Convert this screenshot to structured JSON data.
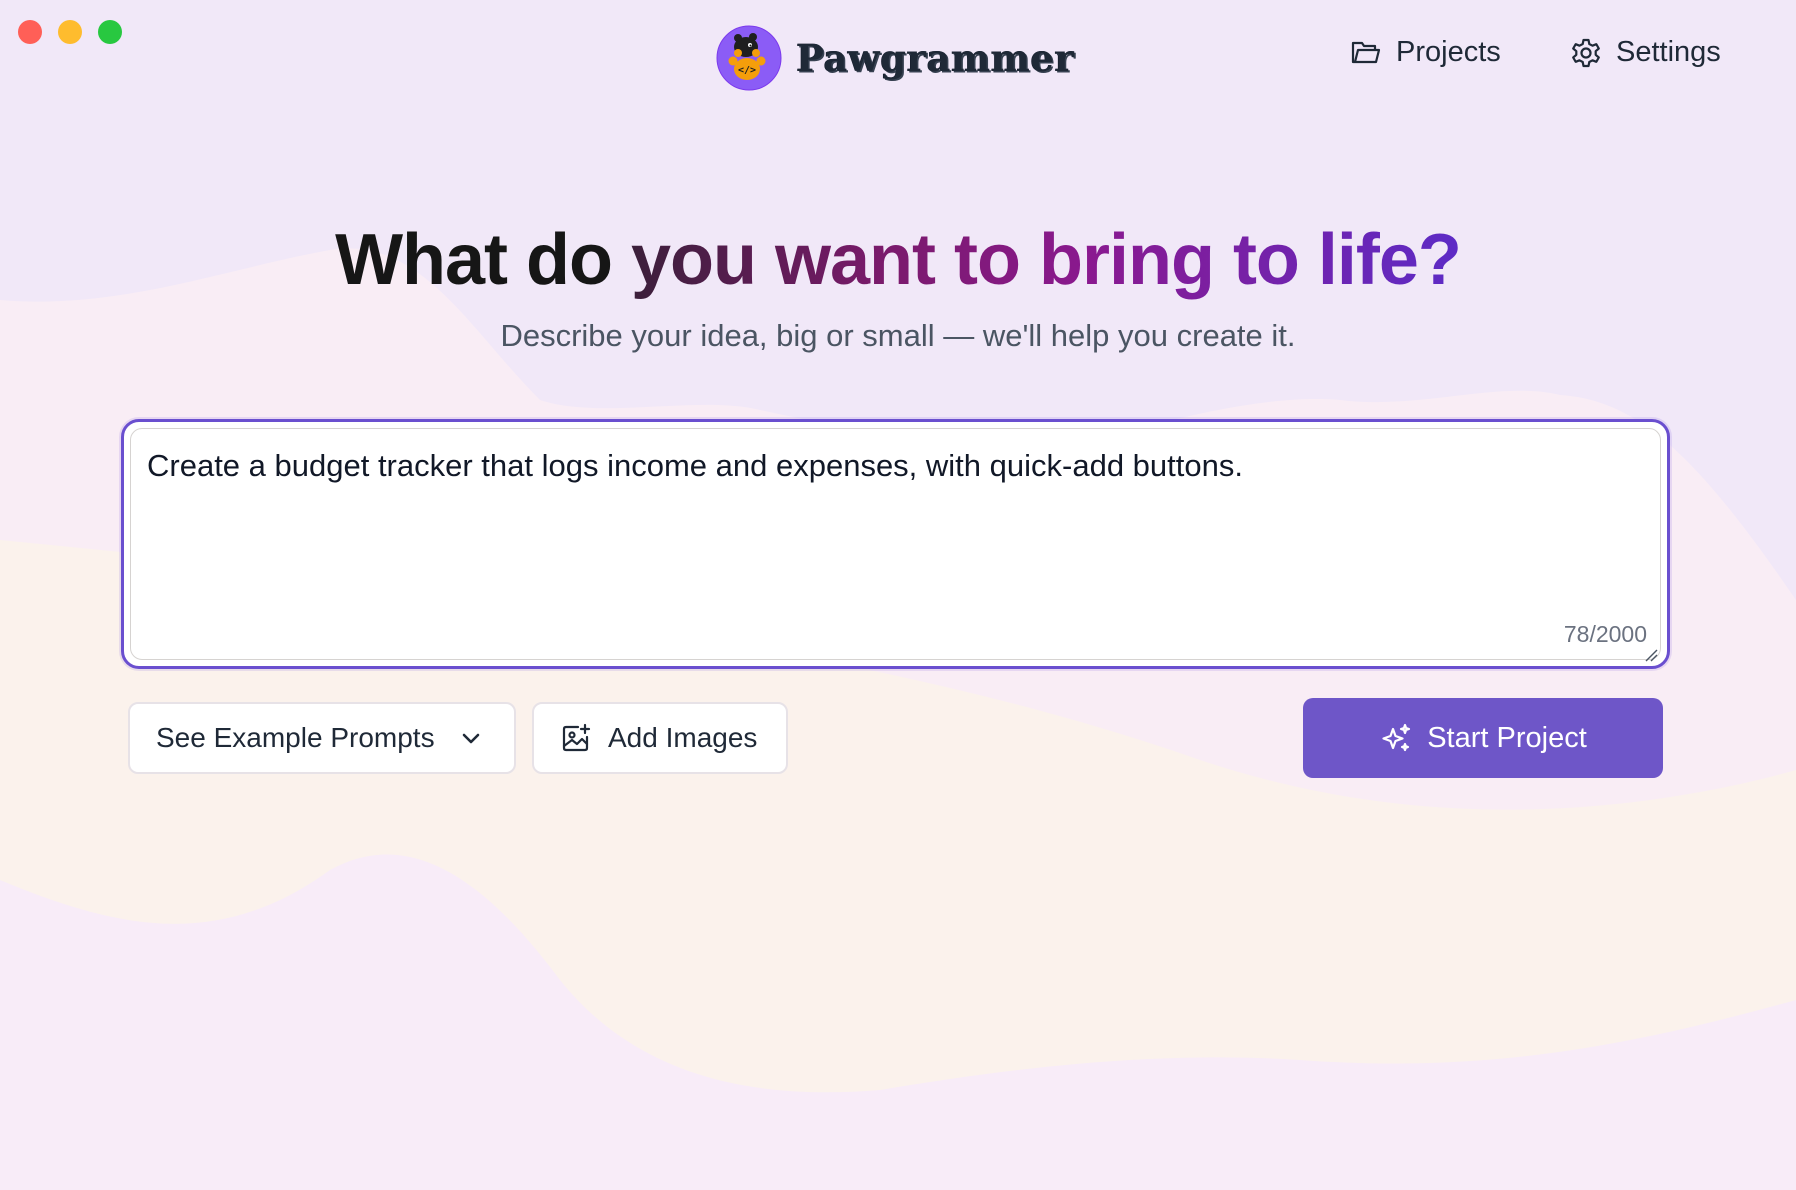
{
  "window": {
    "traffic_lights": [
      {
        "name": "close",
        "color": "#ff5f57"
      },
      {
        "name": "minimize",
        "color": "#febc2e"
      },
      {
        "name": "zoom",
        "color": "#28c840"
      }
    ]
  },
  "header": {
    "app_name": "Pawgrammer",
    "logo_icon": "paw-code-logo",
    "nav": {
      "projects_label": "Projects",
      "projects_icon": "folder-icon",
      "settings_label": "Settings",
      "settings_icon": "gear-icon"
    }
  },
  "hero": {
    "headline_plain": "What do ",
    "headline_highlight": "you want to bring to life?",
    "subheadline": "Describe your idea, big or small — we'll help you create it."
  },
  "prompt": {
    "value": "Create a budget tracker that logs income and expenses, with quick-add buttons.",
    "char_count": "78/2000"
  },
  "actions": {
    "examples_label": "See Example Prompts",
    "examples_icon": "chevron-down-icon",
    "add_images_label": "Add Images",
    "add_images_icon": "image-plus-icon",
    "start_label": "Start Project",
    "start_icon": "sparkles-icon"
  },
  "colors": {
    "accent": "#6e56c8",
    "focus_border": "#6a4fcf",
    "background": "#f3e9f8"
  }
}
